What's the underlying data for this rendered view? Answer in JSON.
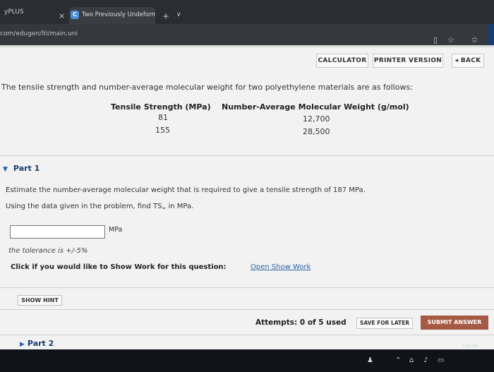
{
  "browser": {
    "left_tab_title": "yPLUS",
    "active_tab_title": "Two Previously Undeformed",
    "url": "com/edugen/lti/main.uni",
    "tab_close_glyph": "×",
    "new_tab_glyph": "+",
    "tab_menu_glyph": "∨"
  },
  "toolbar": {
    "calculator": "CALCULATOR",
    "printer_version": "PRINTER VERSION",
    "back": "◂ BACK"
  },
  "problem": {
    "intro": "The tensile strength and number-average molecular weight for two polyethylene materials are as follows:",
    "table": {
      "headers": [
        "Tensile Strength (MPa)",
        "Number-Average Molecular Weight (g/mol)"
      ],
      "rows": [
        [
          "81",
          "12,700"
        ],
        [
          "155",
          "28,500"
        ]
      ]
    }
  },
  "part1": {
    "title": "Part 1",
    "question": "Estimate the number-average molecular weight that is required to give a tensile strength of 187 MPa.",
    "data_prefix": "Using the data given in the problem, find TS",
    "data_sub": "∞",
    "data_suffix": " in MPa.",
    "answer_value": "",
    "unit": "MPa",
    "tolerance": "the tolerance is +/-5%",
    "show_work_prompt": "Click if you would like to Show Work for this question:",
    "show_work_link": "Open Show Work",
    "show_hint": "SHOW HINT",
    "attempts": "Attempts: 0 of 5 used",
    "save_for_later": "SAVE FOR LATER",
    "submit_answer": "SUBMIT ANSWER"
  },
  "part2": {
    "title": "Part 2"
  },
  "taskbar": {
    "clock": "4:45 PM"
  },
  "colors": {
    "accent": "#2a62a8",
    "submit": "#a65a44",
    "heading": "#1b3d6d"
  }
}
